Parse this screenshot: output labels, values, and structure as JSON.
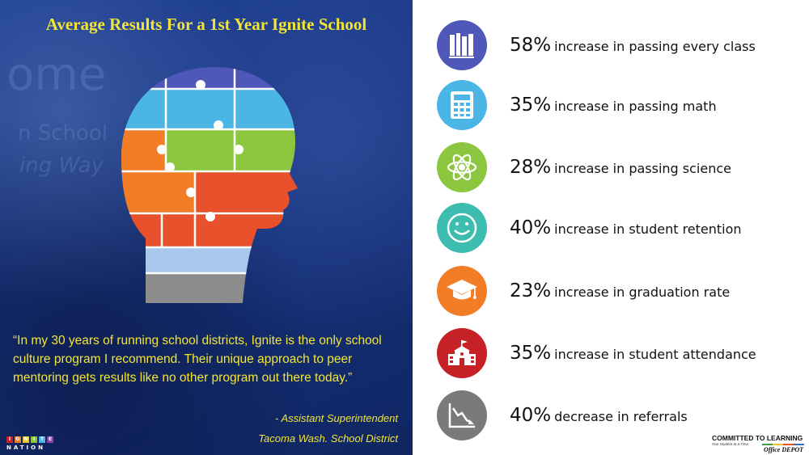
{
  "title": "Average Results For a 1st Year Ignite School",
  "background_words": [
    "ome",
    "n School",
    "ing Way"
  ],
  "quote": "“In my 30 years of running school districts, Ignite is the only school culture program I recommend. Their unique approach to peer mentoring gets results like no other program out there today.”",
  "attribution": {
    "line1": "-     Assistant Superintendent",
    "line2": "Tacoma Wash. School District"
  },
  "logo": {
    "letters": [
      "I",
      "G",
      "N",
      "I",
      "T",
      "E"
    ],
    "word": "NATION"
  },
  "stats": [
    {
      "percent": "58%",
      "label": "increase in passing every class",
      "icon": "books-icon",
      "color": "#4f57b8"
    },
    {
      "percent": "35%",
      "label": "increase in passing math",
      "icon": "calculator-icon",
      "color": "#4bb5e6"
    },
    {
      "percent": "28%",
      "label": "increase in passing science",
      "icon": "atom-icon",
      "color": "#8cc63f"
    },
    {
      "percent": "40%",
      "label": "increase in student retention",
      "icon": "smiley-icon",
      "color": "#3dbdb0"
    },
    {
      "percent": "23%",
      "label": "increase in graduation rate",
      "icon": "graduation-cap-icon",
      "color": "#f37c27"
    },
    {
      "percent": "35%",
      "label": "increase in student attendance",
      "icon": "school-building-icon",
      "color": "#c62127"
    },
    {
      "percent": "40%",
      "label": "decrease in referrals",
      "icon": "declining-chart-icon",
      "color": "#7a7a7a"
    }
  ],
  "partner": {
    "main": "COMMITTED TO LEARNING",
    "sub": "One Student at a Time",
    "brand": "Office DEPOT"
  },
  "colors": {
    "accent_yellow": "#f3e536",
    "panel_blue": "#1a3888",
    "puzzle_blue": "#4f57b8",
    "puzzle_light_blue": "#4bb5e6",
    "puzzle_green": "#8cc63f",
    "puzzle_orange": "#f37c27",
    "puzzle_red": "#e8512c"
  }
}
